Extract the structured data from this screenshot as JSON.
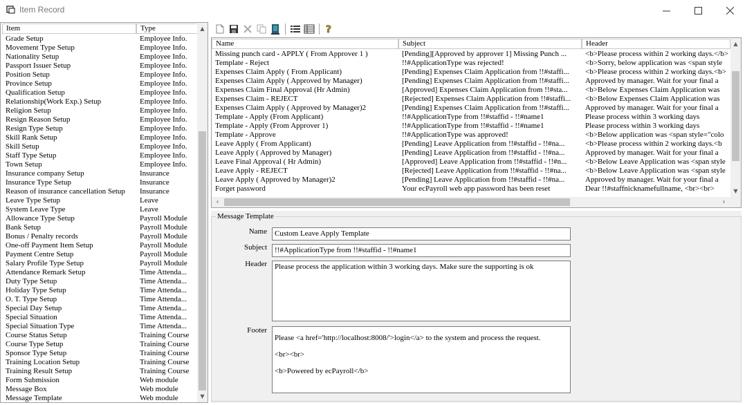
{
  "window": {
    "title": "Item Record",
    "minimize": "—",
    "maximize": "☐",
    "close": "✕"
  },
  "left_list": {
    "headers": {
      "item": "Item",
      "type": "Type"
    },
    "rows": [
      [
        "Grade Setup",
        "Employee Info."
      ],
      [
        "Movement Type Setup",
        "Employee Info."
      ],
      [
        "Nationality Setup",
        "Employee Info."
      ],
      [
        "Passport Issuer Setup",
        "Employee Info."
      ],
      [
        "Position Setup",
        "Employee Info."
      ],
      [
        "Province Setup",
        "Employee Info."
      ],
      [
        "Qualification Setup",
        "Employee Info."
      ],
      [
        "Relationship(Work Exp.) Setup",
        "Employee Info."
      ],
      [
        "Religion Setup",
        "Employee Info."
      ],
      [
        "Resign Reason Setup",
        "Employee Info."
      ],
      [
        "Resign Type Setup",
        "Employee Info."
      ],
      [
        "Skill Rank Setup",
        "Employee Info."
      ],
      [
        "Skill Setup",
        "Employee Info."
      ],
      [
        "Staff Type Setup",
        "Employee Info."
      ],
      [
        "Town Setup",
        "Employee Info."
      ],
      [
        "Insurance company Setup",
        "Insurance"
      ],
      [
        "Insurance Type Setup",
        "Insurance"
      ],
      [
        "Reason of insurance cancellation Setup",
        "Insurance"
      ],
      [
        "Leave Type Setup",
        "Leave"
      ],
      [
        "System Leave Type",
        "Leave"
      ],
      [
        "Allowance Type Setup",
        "Payroll Module"
      ],
      [
        "Bank Setup",
        "Payroll Module"
      ],
      [
        "Bonus / Penalty records",
        "Payroll Module"
      ],
      [
        "One-off Payment Item Setup",
        "Payroll Module"
      ],
      [
        "Payment Centre Setup",
        "Payroll Module"
      ],
      [
        "Salary Profile Type Setup",
        "Payroll Module"
      ],
      [
        "Attendance Remark Setup",
        "Time Attenda..."
      ],
      [
        "Duty Type Setup",
        "Time Attenda..."
      ],
      [
        "Holiday Type Setup",
        "Time Attenda..."
      ],
      [
        "O. T. Type Setup",
        "Time Attenda..."
      ],
      [
        "Special Day Setup",
        "Time Attenda..."
      ],
      [
        "Special Situation",
        "Time Attenda..."
      ],
      [
        "Special Situation Type",
        "Time Attenda..."
      ],
      [
        "Course Status Setup",
        "Training Course"
      ],
      [
        "Course Type Setup",
        "Training Course"
      ],
      [
        "Sponsor Type Setup",
        "Training Course"
      ],
      [
        "Training Location Setup",
        "Training Course"
      ],
      [
        "Training Result Setup",
        "Training Course"
      ],
      [
        "Form Submission",
        "Web module"
      ],
      [
        "Message Box",
        "Web module"
      ],
      [
        "Message Template",
        "Web module"
      ]
    ]
  },
  "toolbar": {
    "icons": [
      "new-icon",
      "save-icon",
      "delete-icon",
      "copy-icon",
      "exit-icon",
      "list-view-icon",
      "detail-view-icon",
      "help-icon"
    ]
  },
  "grid": {
    "headers": {
      "name": "Name",
      "subject": "Subject",
      "header": "Header"
    },
    "rows": [
      [
        "Missing punch card - APPLY ( From Approver 1 )",
        "[Pending][Approved by approver 1] Missing Punch ...",
        "<b>Please process within 2 working days.</b>"
      ],
      [
        "Template - Reject",
        "!!#ApplicationType was rejected!",
        "<b>Sorry, below application was <span style"
      ],
      [
        "Expenses Claim Apply ( From Applicant)",
        "[Pending] Expenses Claim Application from !!#staffi...",
        "<b>Please process within 2 working days.<b>"
      ],
      [
        "Expenses Claim Apply ( Approved by Manager)",
        "[Pending] Expenses Claim Application from !!#staffi...",
        "Approved by manager. Wait for your final a"
      ],
      [
        "Expenses Claim Final Approval (Hr Admin)",
        "[Approved] Expenses Claim Application from !!#sta...",
        "<b>Below Expenses Claim Application was"
      ],
      [
        "Expenses Claim - REJECT",
        "[Rejected] Expenses Claim Application from !!#staffi...",
        "<b>Below Expenses Claim Application was"
      ],
      [
        "Expenses Claim Apply ( Approved by Manager)2",
        "[Pending] Expenses Claim Application from !!#staffi...",
        "Approved by manager. Wait for your final a"
      ],
      [
        "Template - Apply (From Applicant)",
        "!!#ApplicationType from !!#staffid - !!#name1",
        "Please process within 3 working days"
      ],
      [
        "Template - Apply (From Approver 1)",
        "!!#ApplicationType from !!#staffid - !!#name1",
        "Please process within 3 working days"
      ],
      [
        "Template - Approve",
        "!!#ApplicationType was approved!",
        "<b>Below application was <span style=\"colo"
      ],
      [
        "Leave Apply ( From Applicant)",
        "[Pending] Leave Application from !!#staffid - !!#na...",
        "<b>Please process within 2 working days.<b"
      ],
      [
        "Leave Apply ( Approved by Manager)",
        "[Pending] Leave Application from !!#staffid - !!#na...",
        "Approved by manager. Wait for your final a"
      ],
      [
        "Leave Final Approval ( Hr Admin)",
        "[Approved] Leave Application from !!#staffid - !!#n...",
        "<b>Below Leave Application was <span style"
      ],
      [
        "Leave Apply - REJECT",
        "[Rejected] Leave Application from !!#staffid - !!#na...",
        "<b>Below Leave Application was <span style"
      ],
      [
        "Leave Apply ( Approved by Manager)2",
        "[Pending] Leave Application from !!#staffid - !!#na...",
        "Approved by manager. Wait for your final a"
      ],
      [
        "Forget password",
        "Your ecPayroll web app password has been reset",
        "Dear !!#staffnicknamefullname,   <br><br>"
      ]
    ]
  },
  "form": {
    "group_title": "Message Template",
    "name_label": "Name",
    "name_value": "Custom Leave Apply Template",
    "subject_label": "Subject",
    "subject_value": "!!#ApplicationType from !!#staffid - !!#name1",
    "header_label": "Header",
    "header_value": "Please process the application within 3 working days. Make sure the supporting is ok",
    "footer_label": "Footer",
    "footer_lines": [
      "Please <a href='http://localhost:8008/'>login</a> to the system and process the request.",
      "<br><br>",
      "<b>Powered by ecPayroll</b>"
    ]
  }
}
